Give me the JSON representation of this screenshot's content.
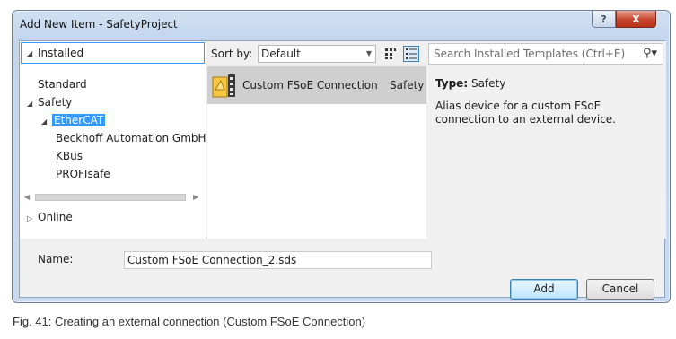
{
  "window": {
    "title": "Add New Item - SafetyProject",
    "help_glyph": "?",
    "close_glyph": "X"
  },
  "left_panel": {
    "header": "Installed",
    "tree": [
      {
        "label": "Standard"
      },
      {
        "label": "Safety"
      },
      {
        "label": "EtherCAT",
        "selected": true
      },
      {
        "label": "Beckhoff Automation GmbH"
      },
      {
        "label": "KBus"
      },
      {
        "label": "PROFIsafe"
      },
      {
        "label": "Online"
      }
    ]
  },
  "toolbar": {
    "sort_label": "Sort by:",
    "sort_value": "Default",
    "search_placeholder": "Search Installed Templates (Ctrl+E)"
  },
  "templates": [
    {
      "name": "Custom FSoE Connection",
      "category": "Safety"
    }
  ],
  "details": {
    "type_label": "Type:",
    "type_value": "Safety",
    "description": "Alias device for a custom FSoE connection to an external device."
  },
  "name_field": {
    "label": "Name:",
    "value": "Custom FSoE Connection_2.sds"
  },
  "buttons": {
    "add": "Add",
    "cancel": "Cancel"
  },
  "caption": "Fig. 41: Creating an external connection (Custom FSoE Connection)",
  "colors": {
    "selection": "#3399ff",
    "title_bg": "#c9daf0",
    "close_red": "#c8452c"
  }
}
